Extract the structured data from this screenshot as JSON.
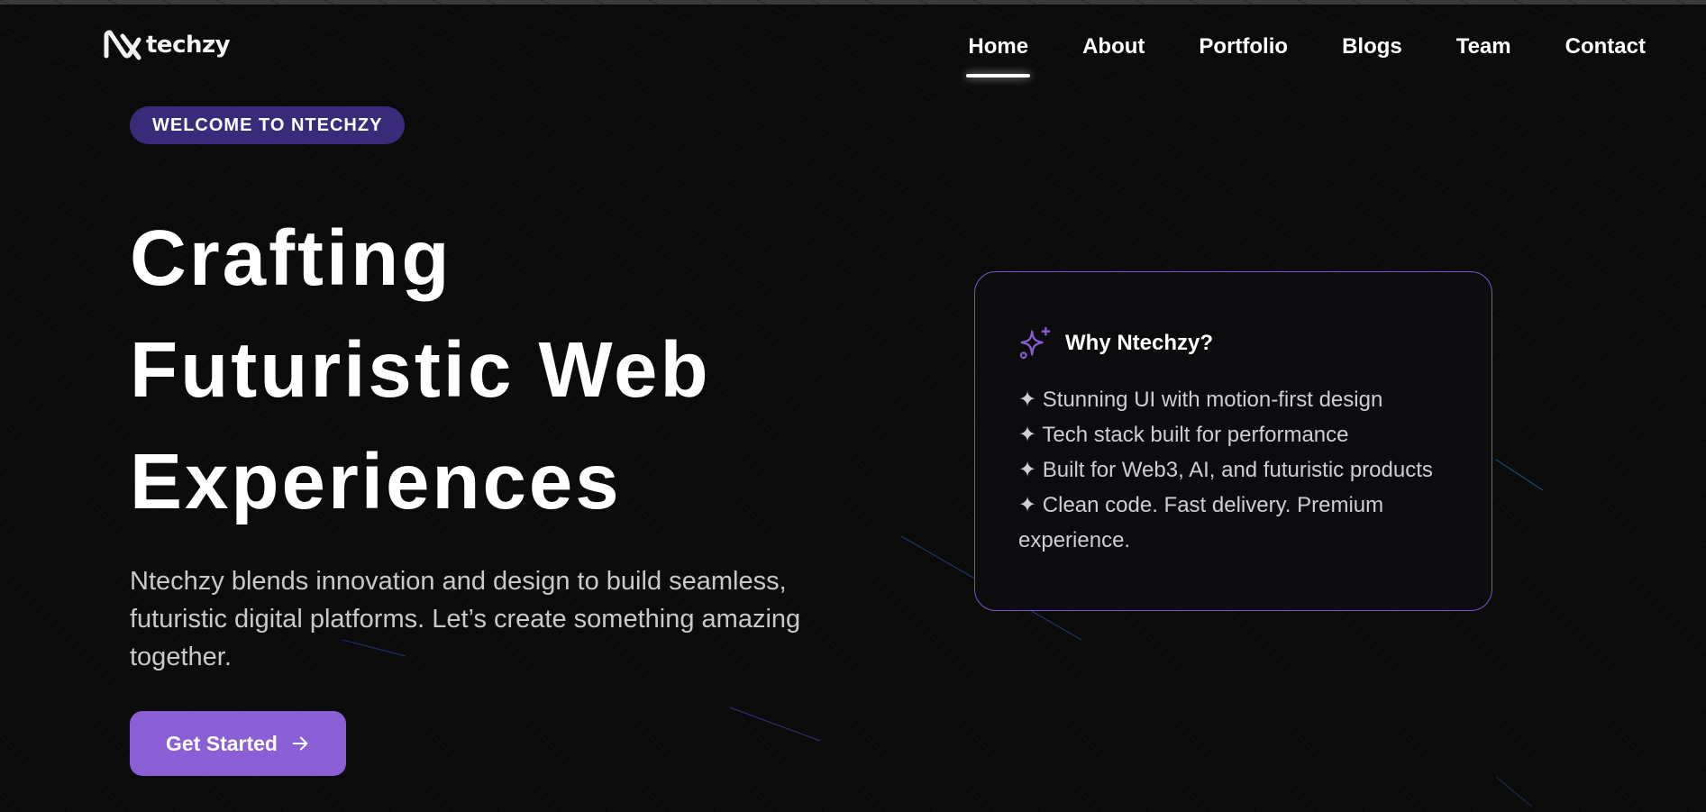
{
  "brand": {
    "logo_icon": "ntechzy-logo-icon",
    "name": "techzy"
  },
  "nav": {
    "items": [
      {
        "label": "Home",
        "active": true
      },
      {
        "label": "About",
        "active": false
      },
      {
        "label": "Portfolio",
        "active": false
      },
      {
        "label": "Blogs",
        "active": false
      },
      {
        "label": "Team",
        "active": false
      },
      {
        "label": "Contact",
        "active": false
      }
    ]
  },
  "hero": {
    "badge": "WELCOME TO NTECHZY",
    "headline": [
      "Crafting",
      "Futuristic Web",
      "Experiences"
    ],
    "lead": "Ntechzy blends innovation and design to build seamless, futuristic digital platforms. Let’s create something amazing together.",
    "cta": {
      "label": "Get Started",
      "icon": "arrow-right-icon"
    }
  },
  "card": {
    "icon": "sparkle-icon",
    "title": "Why Ntechzy?",
    "items": [
      "✦ Stunning UI with motion-first design",
      "✦ Tech stack built for performance",
      "✦ Built for Web3, AI, and futuristic products",
      "✦ Clean code. Fast delivery. Premium experience."
    ]
  },
  "colors": {
    "background": "#0b0b0c",
    "accent": "#8a5fd6",
    "badge": "#3a2a7a",
    "card_border": "#7a56c8",
    "text_muted": "#c9c9cc"
  }
}
